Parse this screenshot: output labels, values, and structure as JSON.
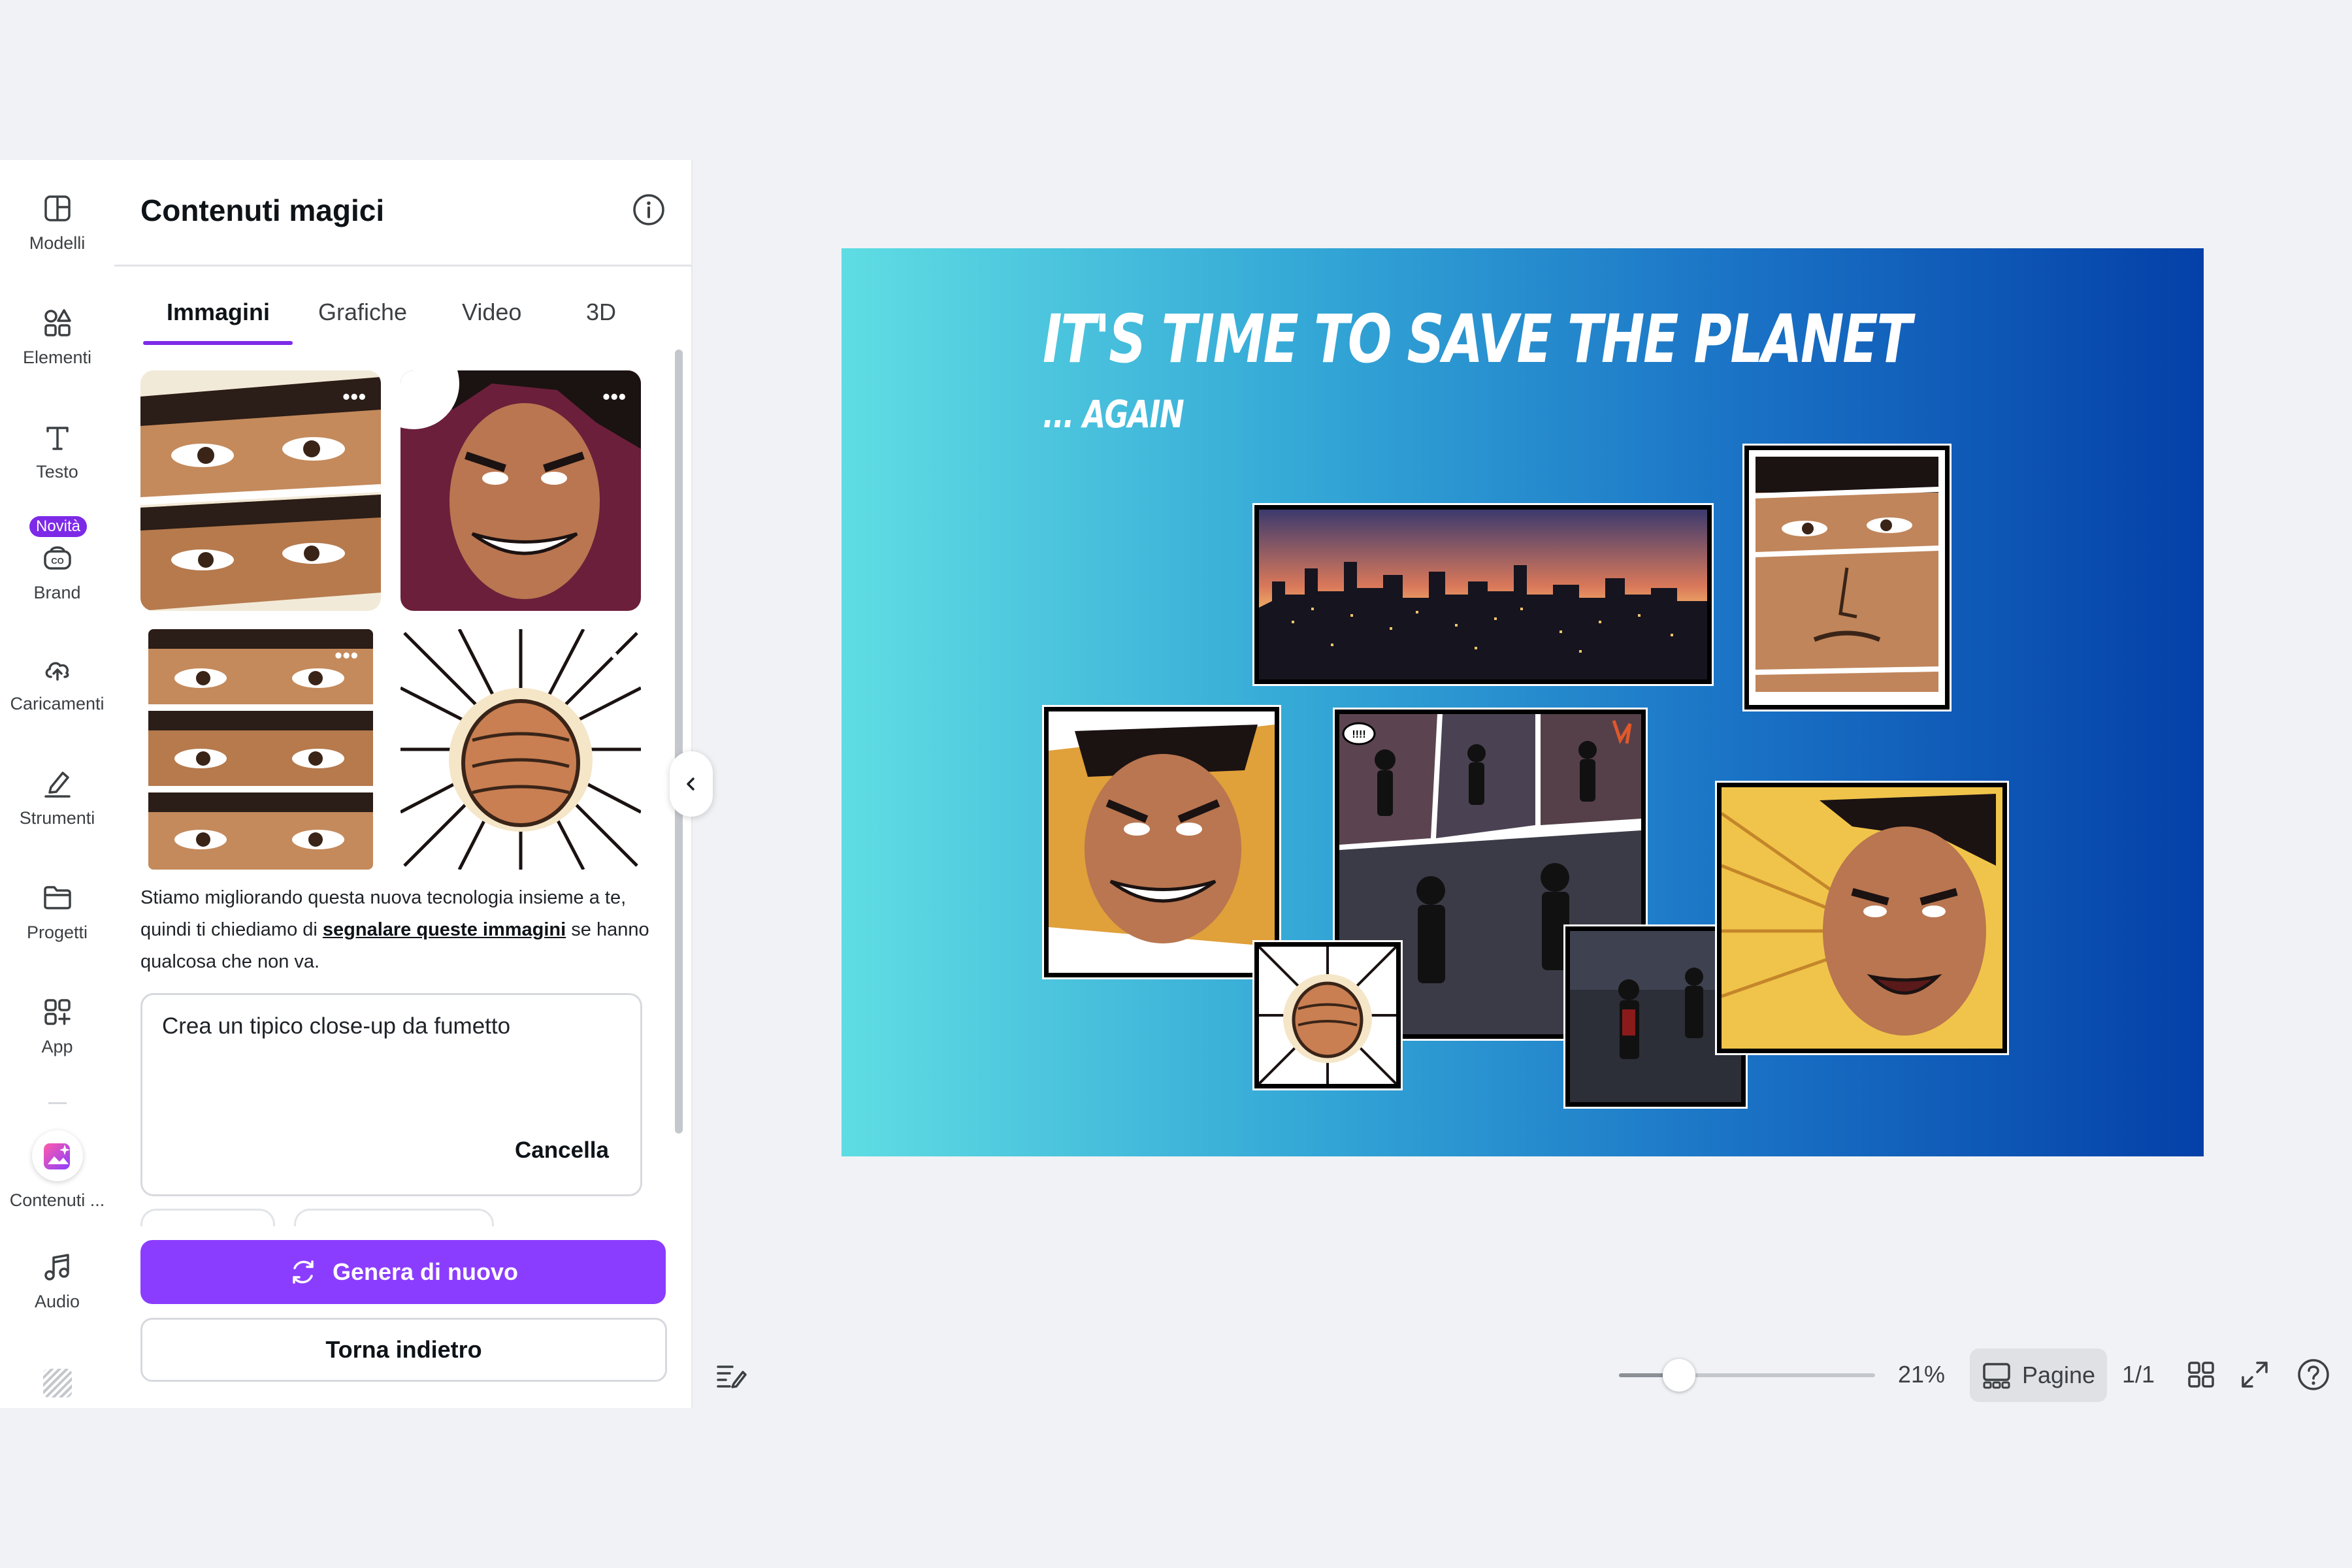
{
  "rail": {
    "items": [
      {
        "label": "Modelli",
        "icon": "layout-icon"
      },
      {
        "label": "Elementi",
        "icon": "shapes-icon"
      },
      {
        "label": "Testo",
        "icon": "text-icon"
      },
      {
        "label": "Brand",
        "icon": "brand-icon",
        "badge": "Novità"
      },
      {
        "label": "Caricamenti",
        "icon": "cloud-upload-icon"
      },
      {
        "label": "Strumenti",
        "icon": "pen-tool-icon"
      },
      {
        "label": "Progetti",
        "icon": "folder-icon"
      },
      {
        "label": "App",
        "icon": "apps-grid-icon"
      },
      {
        "label": "Contenuti ...",
        "icon": "magic-media-icon"
      },
      {
        "label": "Audio",
        "icon": "music-note-icon"
      }
    ]
  },
  "panel": {
    "title": "Contenuti magici",
    "tabs": [
      "Immagini",
      "Grafiche",
      "Video",
      "3D"
    ],
    "active_tab": "Immagini",
    "more_label": "•••",
    "disclaimer_prefix": "Stiamo migliorando questa nuova tecnologia insieme a te, quindi ti chiediamo di ",
    "disclaimer_link": "segnalare queste immagini",
    "disclaimer_suffix": " se hanno qualcosa che non va.",
    "prompt": "Crea un tipico close-up da fumetto",
    "cancel_label": "Cancella",
    "generate_label": "Genera di nuovo",
    "back_label": "Torna indietro"
  },
  "slide": {
    "title": "IT'S TIME TO SAVE THE PLANET",
    "subtitle": "... AGAIN",
    "speech_bubble": "!!!!"
  },
  "toolbar": {
    "zoom": "21%",
    "zoom_level": 0.21,
    "pages_label": "Pagine",
    "page_count": "1/1"
  },
  "colors": {
    "accent": "#8b3dff",
    "tab_underline": "#7d2ae8",
    "slide_gradient_start": "#5fdde3",
    "slide_gradient_end": "#0440a8"
  }
}
